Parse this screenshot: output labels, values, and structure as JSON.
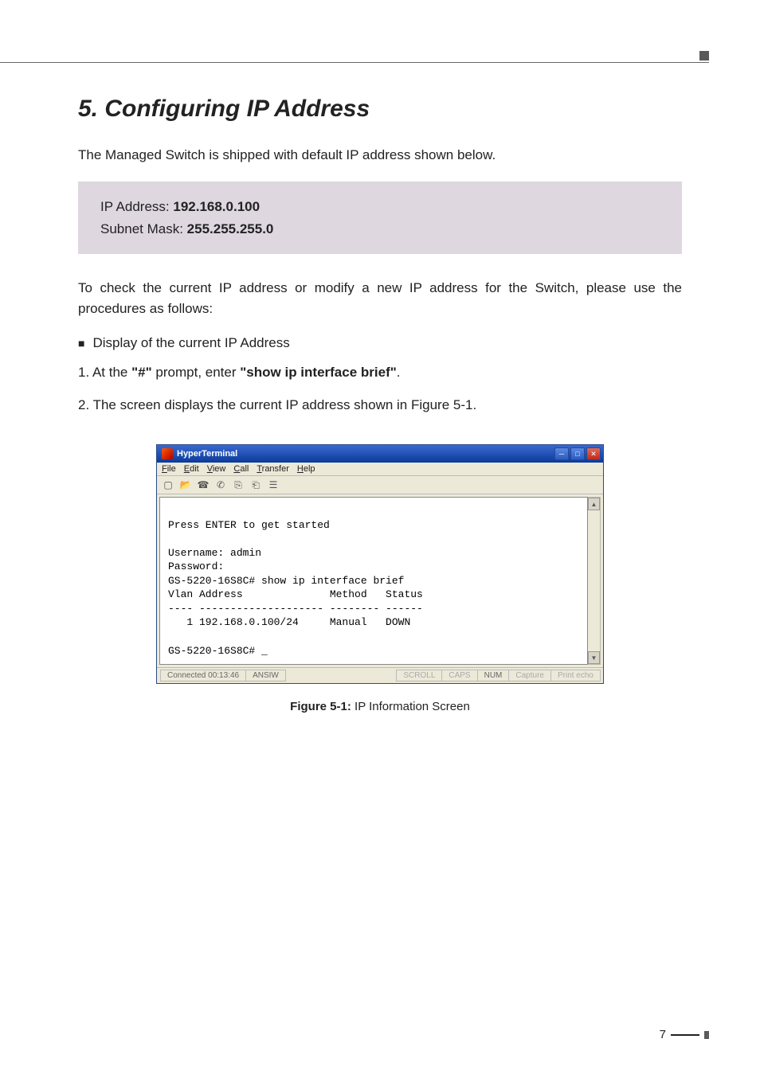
{
  "heading": "5. Configuring IP Address",
  "intro": "The Managed Switch is shipped with default IP address shown below.",
  "info_box": {
    "line1_label": "IP Address: ",
    "line1_value": "192.168.0.100",
    "line2_label": "Subnet Mask: ",
    "line2_value": "255.255.255.0"
  },
  "para2": "To check the current IP address or modify a new IP address for the Switch, please use the procedures as follows:",
  "bullet1": "Display of the current IP Address",
  "step1_pre": "1. At the ",
  "step1_bold1": "\"#\"",
  "step1_mid": " prompt, enter ",
  "step1_bold2": "\"show ip interface brief\"",
  "step1_post": ".",
  "step2": "2. The screen displays the current IP address shown in Figure 5-1.",
  "terminal": {
    "title": "HyperTerminal",
    "menu": [
      "File",
      "Edit",
      "View",
      "Call",
      "Transfer",
      "Help"
    ],
    "body": "\nPress ENTER to get started\n\nUsername: admin\nPassword:\nGS-5220-16S8C# show ip interface brief\nVlan Address              Method   Status\n---- -------------------- -------- ------\n   1 192.168.0.100/24     Manual   DOWN\n\nGS-5220-16S8C# _",
    "status": {
      "connected": "Connected 00:13:46",
      "mode": "ANSIW",
      "items": [
        "SCROLL",
        "CAPS",
        "NUM",
        "Capture",
        "Print echo"
      ]
    }
  },
  "figure_caption_bold": "Figure 5-1:",
  "figure_caption_rest": "  IP Information Screen",
  "page_number": "7"
}
